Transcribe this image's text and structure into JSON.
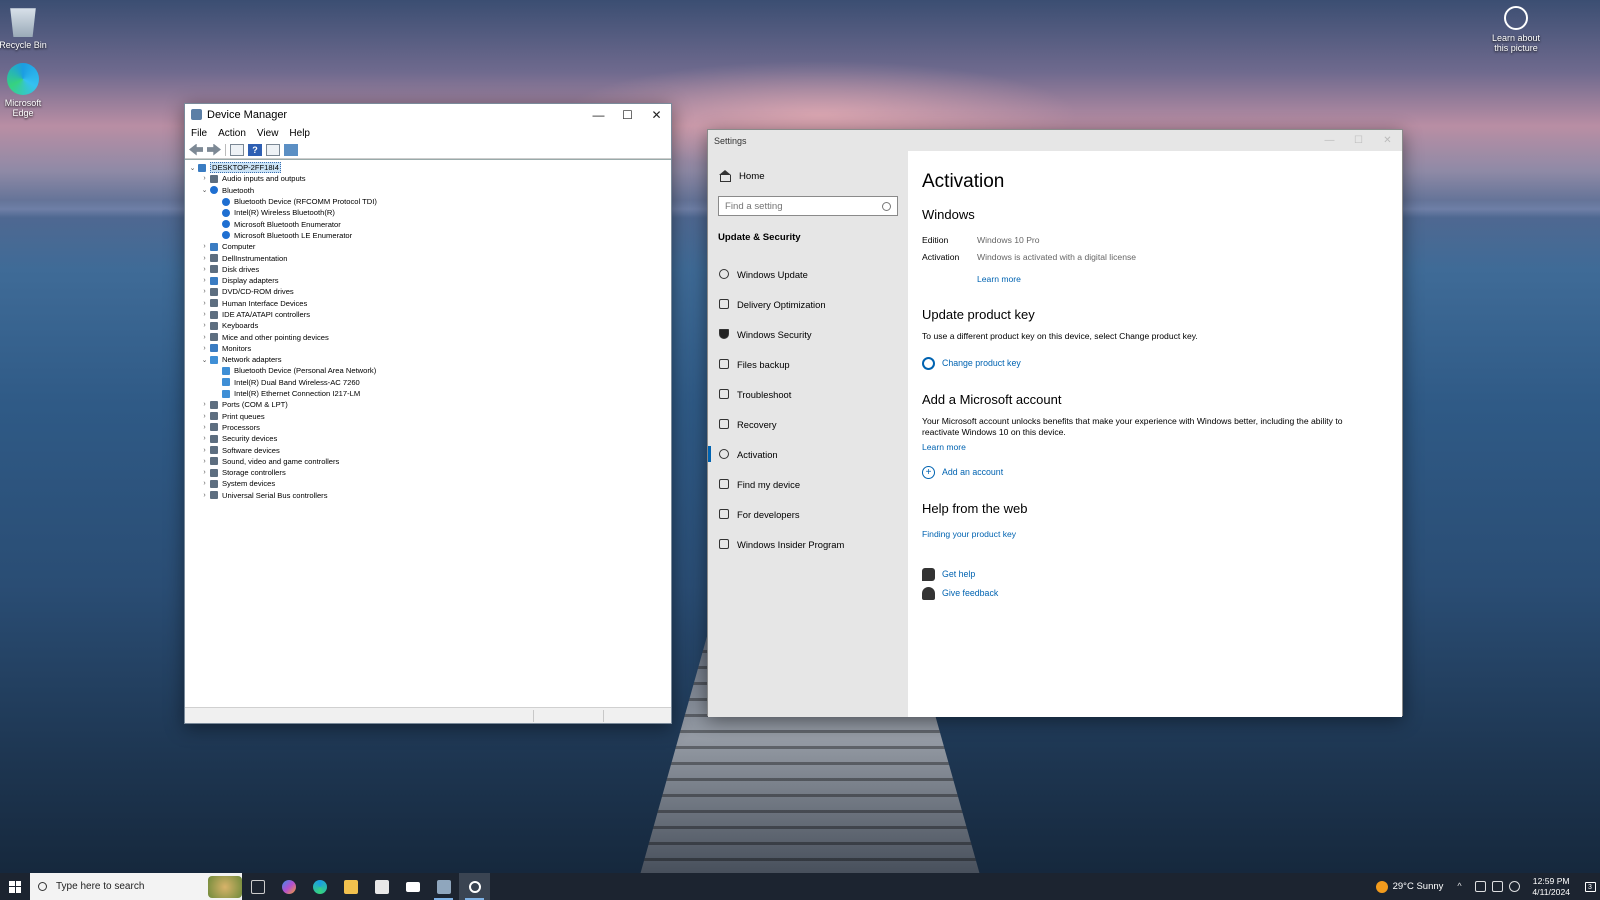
{
  "desktop": {
    "icons": [
      {
        "label": "Recycle Bin"
      },
      {
        "label": "Microsoft Edge"
      },
      {
        "label": "Learn about this picture"
      }
    ]
  },
  "device_manager": {
    "title": "Device Manager",
    "menu": [
      "File",
      "Action",
      "View",
      "Help"
    ],
    "tree": [
      {
        "label": "DESKTOP-2FF18I4",
        "level": 0,
        "expander": "⌄",
        "selected": true,
        "icon": "computer-icon"
      },
      {
        "label": "Audio inputs and outputs",
        "level": 1,
        "expander": "›",
        "icon": "speaker-icon"
      },
      {
        "label": "Bluetooth",
        "level": 1,
        "expander": "⌄",
        "icon": "bluetooth-icon"
      },
      {
        "label": "Bluetooth Device (RFCOMM Protocol TDI)",
        "level": 2,
        "expander": "",
        "icon": "bluetooth-icon"
      },
      {
        "label": "Intel(R) Wireless Bluetooth(R)",
        "level": 2,
        "expander": "",
        "icon": "bluetooth-icon"
      },
      {
        "label": "Microsoft Bluetooth Enumerator",
        "level": 2,
        "expander": "",
        "icon": "bluetooth-icon"
      },
      {
        "label": "Microsoft Bluetooth LE Enumerator",
        "level": 2,
        "expander": "",
        "icon": "bluetooth-icon"
      },
      {
        "label": "Computer",
        "level": 1,
        "expander": "›",
        "icon": "computer-icon"
      },
      {
        "label": "DellInstrumentation",
        "level": 1,
        "expander": "›",
        "icon": "device-icon"
      },
      {
        "label": "Disk drives",
        "level": 1,
        "expander": "›",
        "icon": "disk-icon"
      },
      {
        "label": "Display adapters",
        "level": 1,
        "expander": "›",
        "icon": "display-icon"
      },
      {
        "label": "DVD/CD-ROM drives",
        "level": 1,
        "expander": "›",
        "icon": "dvd-icon"
      },
      {
        "label": "Human Interface Devices",
        "level": 1,
        "expander": "›",
        "icon": "hid-icon"
      },
      {
        "label": "IDE ATA/ATAPI controllers",
        "level": 1,
        "expander": "›",
        "icon": "controller-icon"
      },
      {
        "label": "Keyboards",
        "level": 1,
        "expander": "›",
        "icon": "keyboard-icon"
      },
      {
        "label": "Mice and other pointing devices",
        "level": 1,
        "expander": "›",
        "icon": "mouse-icon"
      },
      {
        "label": "Monitors",
        "level": 1,
        "expander": "›",
        "icon": "monitor-icon"
      },
      {
        "label": "Network adapters",
        "level": 1,
        "expander": "⌄",
        "icon": "network-icon"
      },
      {
        "label": "Bluetooth Device (Personal Area Network)",
        "level": 2,
        "expander": "",
        "icon": "network-icon"
      },
      {
        "label": "Intel(R) Dual Band Wireless-AC 7260",
        "level": 2,
        "expander": "",
        "icon": "network-icon"
      },
      {
        "label": "Intel(R) Ethernet Connection I217-LM",
        "level": 2,
        "expander": "",
        "icon": "network-icon"
      },
      {
        "label": "Ports (COM & LPT)",
        "level": 1,
        "expander": "›",
        "icon": "port-icon"
      },
      {
        "label": "Print queues",
        "level": 1,
        "expander": "›",
        "icon": "printer-icon"
      },
      {
        "label": "Processors",
        "level": 1,
        "expander": "›",
        "icon": "processor-icon"
      },
      {
        "label": "Security devices",
        "level": 1,
        "expander": "›",
        "icon": "security-icon"
      },
      {
        "label": "Software devices",
        "level": 1,
        "expander": "›",
        "icon": "software-icon"
      },
      {
        "label": "Sound, video and game controllers",
        "level": 1,
        "expander": "›",
        "icon": "sound-icon"
      },
      {
        "label": "Storage controllers",
        "level": 1,
        "expander": "›",
        "icon": "storage-icon"
      },
      {
        "label": "System devices",
        "level": 1,
        "expander": "›",
        "icon": "system-icon"
      },
      {
        "label": "Universal Serial Bus controllers",
        "level": 1,
        "expander": "›",
        "icon": "usb-icon"
      }
    ]
  },
  "settings": {
    "title": "Settings",
    "nav": {
      "home": "Home",
      "search_placeholder": "Find a setting",
      "section": "Update & Security",
      "items": [
        {
          "label": "Windows Update",
          "icon": "sync-icon"
        },
        {
          "label": "Delivery Optimization",
          "icon": "delivery-icon"
        },
        {
          "label": "Windows Security",
          "icon": "shield-icon"
        },
        {
          "label": "Files backup",
          "icon": "backup-icon"
        },
        {
          "label": "Troubleshoot",
          "icon": "wrench-icon"
        },
        {
          "label": "Recovery",
          "icon": "recovery-icon"
        },
        {
          "label": "Activation",
          "icon": "check-circle-icon",
          "active": true
        },
        {
          "label": "Find my device",
          "icon": "person-pin-icon"
        },
        {
          "label": "For developers",
          "icon": "developer-icon"
        },
        {
          "label": "Windows Insider Program",
          "icon": "insider-icon"
        }
      ]
    },
    "main": {
      "page_title": "Activation",
      "windows_heading": "Windows",
      "edition_key": "Edition",
      "edition_value": "Windows 10 Pro",
      "activation_key": "Activation",
      "activation_value": "Windows is activated with a digital license",
      "learn_more_1": "Learn more",
      "update_key_heading": "Update product key",
      "update_key_text": "To use a different product key on this device, select Change product key.",
      "change_key_link": "Change product key",
      "ms_account_heading": "Add a Microsoft account",
      "ms_account_text": "Your Microsoft account unlocks benefits that make your experience with Windows better, including the ability to reactivate Windows 10 on this device.",
      "learn_more_2": "Learn more",
      "add_account_link": "Add an account",
      "help_heading": "Help from the web",
      "finding_key_link": "Finding your product key",
      "get_help_link": "Get help",
      "give_feedback_link": "Give feedback"
    }
  },
  "taskbar": {
    "search_placeholder": "Type here to search",
    "weather": "29°C  Sunny",
    "time": "12:59 PM",
    "date": "4/11/2024",
    "notification_count": "3",
    "accent": "#0063b1"
  }
}
